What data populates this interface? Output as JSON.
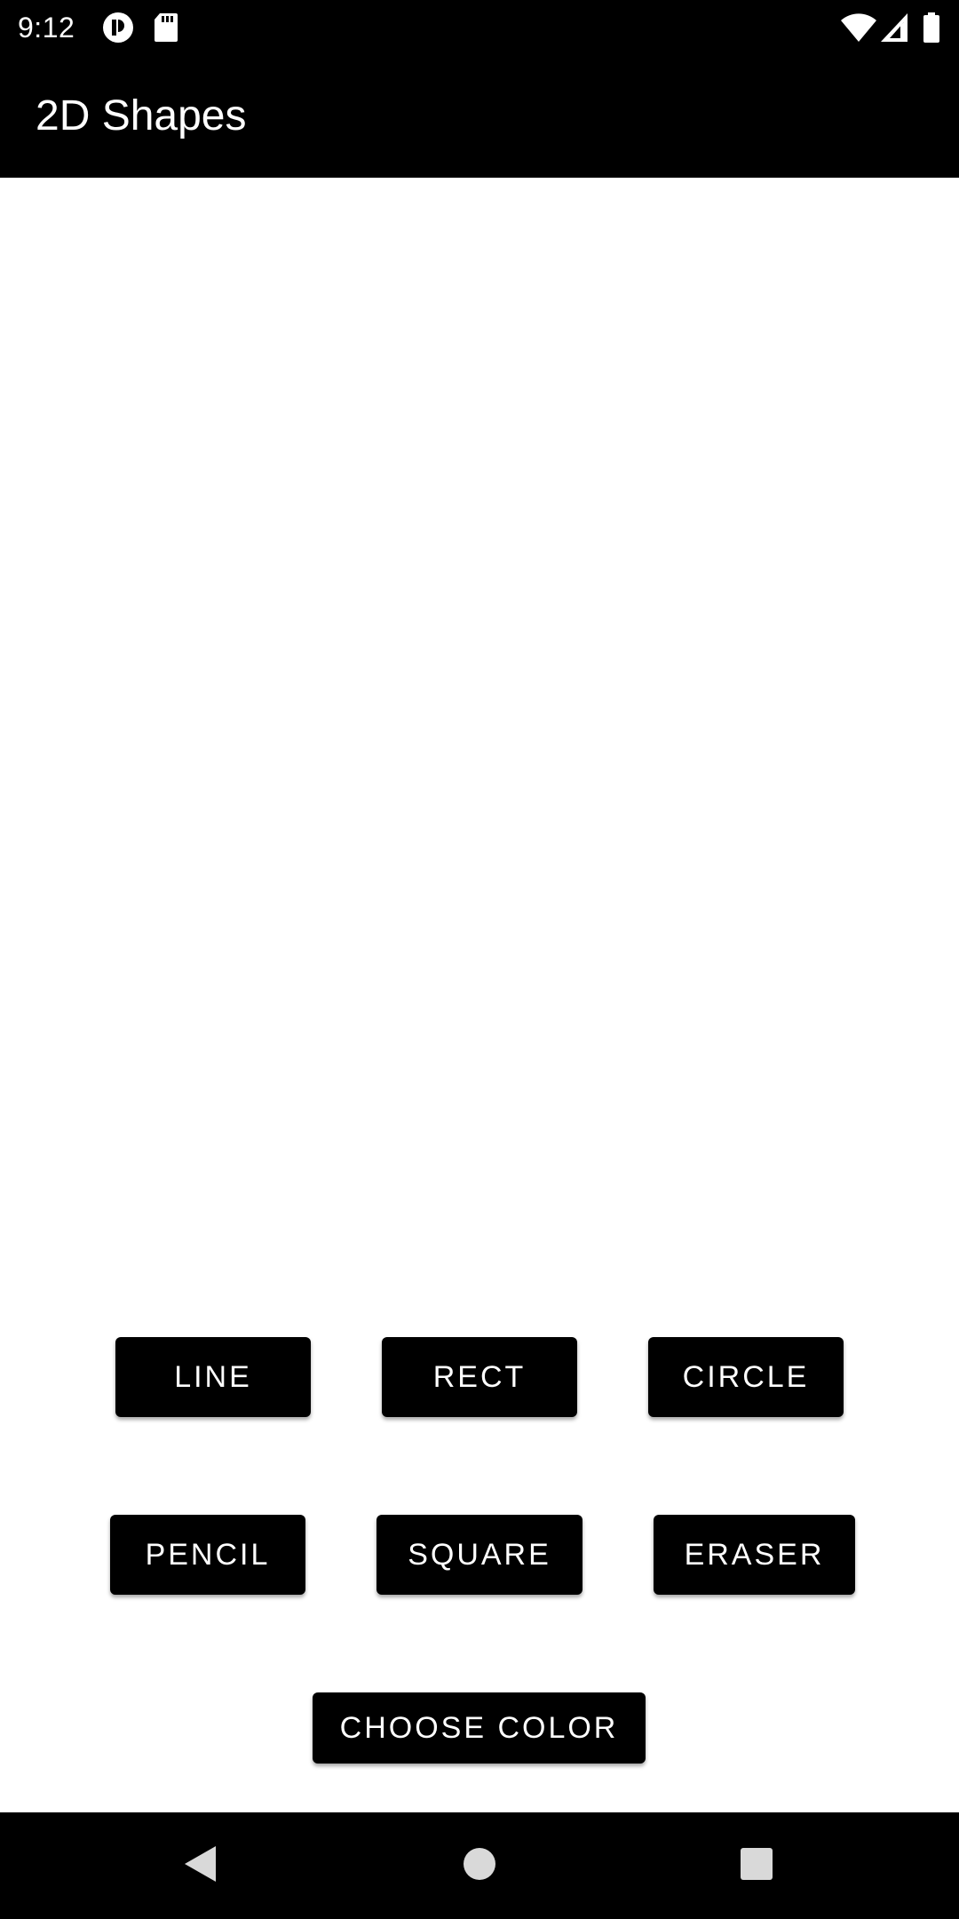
{
  "status_bar": {
    "time": "9:12",
    "notification_icons": [
      "privacy-icon",
      "sd-card-icon"
    ],
    "system_icons": [
      "wifi-icon",
      "cell-signal-icon",
      "battery-icon"
    ]
  },
  "app_bar": {
    "title": "2D Shapes"
  },
  "toolbar": {
    "line_label": "LINE",
    "rect_label": "RECT",
    "circle_label": "CIRCLE",
    "pencil_label": "PENCIL",
    "square_label": "SQUARE",
    "eraser_label": "ERASER",
    "choose_color_label": "CHOOSE COLOR"
  },
  "nav_bar": {
    "icons": [
      "back-icon",
      "home-icon",
      "recents-icon"
    ]
  },
  "colors": {
    "bar_background": "#000000",
    "button_background": "#000000",
    "button_text": "#ffffff",
    "canvas_background": "#ffffff",
    "nav_icon": "#d9d9d9"
  }
}
